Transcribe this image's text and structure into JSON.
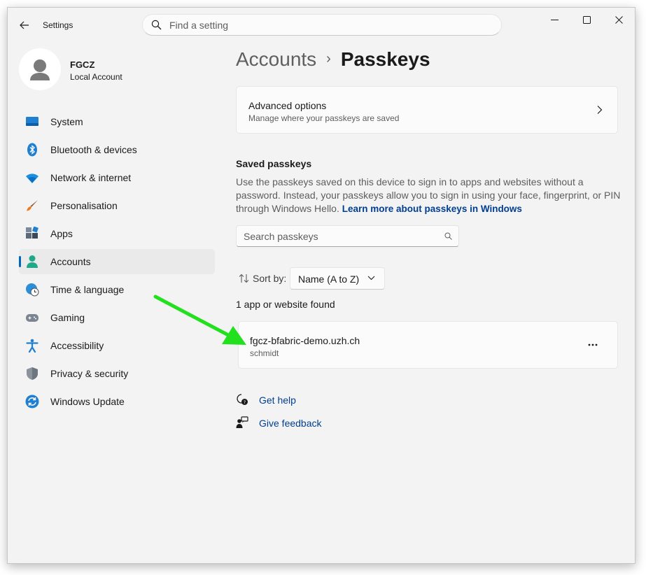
{
  "window": {
    "title": "Settings"
  },
  "search": {
    "placeholder": "Find a setting"
  },
  "profile": {
    "name": "FGCZ",
    "account_type": "Local Account"
  },
  "sidebar": {
    "items": [
      {
        "label": "System",
        "icon": "system-icon"
      },
      {
        "label": "Bluetooth & devices",
        "icon": "bluetooth-icon"
      },
      {
        "label": "Network & internet",
        "icon": "wifi-icon"
      },
      {
        "label": "Personalisation",
        "icon": "brush-icon"
      },
      {
        "label": "Apps",
        "icon": "apps-icon"
      },
      {
        "label": "Accounts",
        "icon": "accounts-icon",
        "selected": true
      },
      {
        "label": "Time & language",
        "icon": "globe-clock-icon"
      },
      {
        "label": "Gaming",
        "icon": "gamepad-icon"
      },
      {
        "label": "Accessibility",
        "icon": "accessibility-icon"
      },
      {
        "label": "Privacy & security",
        "icon": "shield-icon"
      },
      {
        "label": "Windows Update",
        "icon": "windows-update-icon"
      }
    ]
  },
  "breadcrumb": {
    "parent": "Accounts",
    "separator": "›",
    "current": "Passkeys"
  },
  "advanced_options": {
    "title": "Advanced options",
    "subtitle": "Manage where your passkeys are saved"
  },
  "saved_passkeys": {
    "heading": "Saved passkeys",
    "description": "Use the passkeys saved on this device to sign in to apps and websites without a password. Instead, your passkeys allow you to sign in using your face, fingerprint, or PIN through Windows Hello.",
    "learn_more": "Learn more about passkeys in Windows",
    "search_placeholder": "Search passkeys",
    "sort_label": "Sort by:",
    "sort_value": "Name (A to Z)",
    "result_count": "1 app or website found",
    "items": [
      {
        "site": "fgcz-bfabric-demo.uzh.ch",
        "user": "schmidt"
      }
    ]
  },
  "links": {
    "help": "Get help",
    "feedback": "Give feedback"
  },
  "colors": {
    "accent": "#0067c0",
    "link": "#003e92",
    "annotation_arrow": "#22e01e"
  }
}
